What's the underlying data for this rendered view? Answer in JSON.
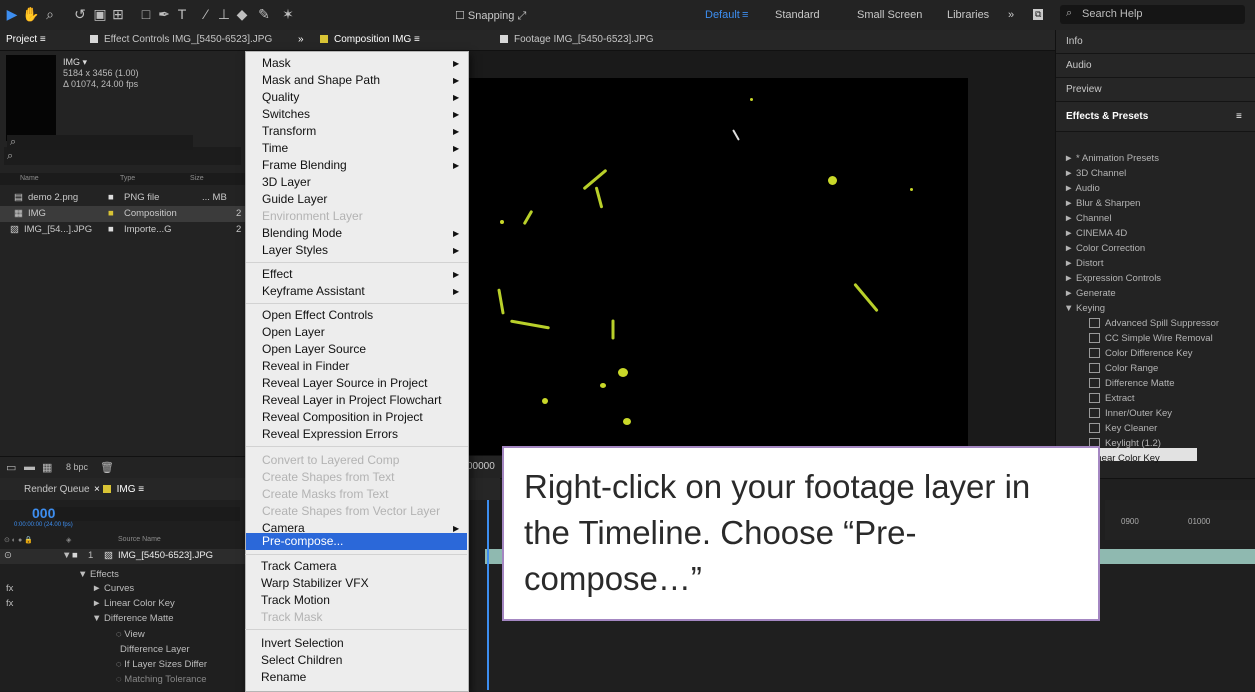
{
  "toolbar": {
    "snapping_label": "Snapping",
    "workspaces": [
      "Default",
      "Standard",
      "Small Screen",
      "Libraries"
    ],
    "overflow": "»",
    "search_placeholder": "Search Help"
  },
  "tabs": {
    "project": "Project",
    "effect_controls": "Effect Controls IMG_[5450-6523].JPG",
    "overflow": "»",
    "composition": "Composition IMG",
    "footage": "Footage IMG_[5450-6523].JPG"
  },
  "project_panel": {
    "item_name": "IMG ▾",
    "dimensions": "5184 x 3456 (1.00)",
    "duration": "Δ 01074, 24.00 fps",
    "search_icon": "⌕",
    "columns": [
      "Name",
      "Type",
      "Size"
    ],
    "rows": [
      {
        "name": "demo 2.png",
        "type": "PNG file",
        "size": "... MB"
      },
      {
        "name": "IMG",
        "type": "Composition",
        "size": "2"
      },
      {
        "name": "IMG_[54...].JPG",
        "type": "Importe...G",
        "size": "2"
      }
    ],
    "bpc": "8 bpc"
  },
  "viewer": {
    "timecode_fragment": "00000"
  },
  "right_panel": {
    "info": "Info",
    "audio": "Audio",
    "preview": "Preview",
    "effects_presets": "Effects & Presets",
    "search_icon": "⌕",
    "categories": [
      "► * Animation Presets",
      "► 3D Channel",
      "► Audio",
      "► Blur & Sharpen",
      "► Channel",
      "► CINEMA 4D",
      "► Color Correction",
      "► Distort",
      "► Expression Controls",
      "► Generate",
      "▼ Keying"
    ],
    "keying_effects": [
      "Advanced Spill Suppressor",
      "CC Simple Wire Removal",
      "Color Difference Key",
      "Color Range",
      "Difference Matte",
      "Extract",
      "Inner/Outer Key",
      "Key Cleaner",
      "Keylight (1.2)",
      "Linear Color Key"
    ]
  },
  "timeline": {
    "render_queue": "Render Queue",
    "comp_tab": "IMG",
    "timecode": "00000",
    "timecode_sub": "0:00:00:00 (24.00 fps)",
    "source_name_col": "Source Name",
    "layer_num": "1",
    "layer_name": "IMG_[5450-6523].JPG",
    "rows": [
      "Effects",
      "Curves",
      "Linear Color Key",
      "Difference Matte",
      "View",
      "Difference Layer",
      "If Layer Sizes Differ",
      "Matching Tolerance"
    ],
    "ruler": [
      "0900",
      "01000"
    ]
  },
  "context_menu": {
    "group1": [
      {
        "label": "Mask",
        "sub": true
      },
      {
        "label": "Mask and Shape Path",
        "sub": true
      },
      {
        "label": "Quality",
        "sub": true
      },
      {
        "label": "Switches",
        "sub": true
      },
      {
        "label": "Transform",
        "sub": true
      },
      {
        "label": "Time",
        "sub": true
      },
      {
        "label": "Frame Blending",
        "sub": true
      },
      {
        "label": "3D Layer",
        "sub": false
      },
      {
        "label": "Guide Layer",
        "sub": false
      },
      {
        "label": "Environment Layer",
        "sub": false,
        "disabled": true
      },
      {
        "label": "Blending Mode",
        "sub": true
      },
      {
        "label": "Layer Styles",
        "sub": true
      }
    ],
    "group2": [
      {
        "label": "Effect",
        "sub": true
      },
      {
        "label": "Keyframe Assistant",
        "sub": true
      }
    ],
    "group3": [
      "Open Effect Controls",
      "Open Layer",
      "Open Layer Source",
      "Reveal in Finder",
      "Reveal Layer Source in Project",
      "Reveal Layer in Project Flowchart",
      "Reveal Composition in Project",
      "Reveal Expression Errors"
    ],
    "group4": [
      {
        "label": "Convert to Layered Comp",
        "disabled": true
      },
      {
        "label": "Create Shapes from Text",
        "disabled": true
      },
      {
        "label": "Create Masks from Text",
        "disabled": true
      },
      {
        "label": "Create Shapes from Vector Layer",
        "disabled": true
      },
      {
        "label": "Camera",
        "sub": true
      },
      {
        "label": "Pre-compose...",
        "highlighted": true
      }
    ],
    "group5": [
      {
        "label": "Track Camera"
      },
      {
        "label": "Warp Stabilizer VFX"
      },
      {
        "label": "Track Motion"
      },
      {
        "label": "Track Mask",
        "disabled": true
      }
    ],
    "group6": [
      "Invert Selection",
      "Select Children",
      "Rename"
    ],
    "arrow": "▶"
  },
  "callout": {
    "text": "Right-click on your footage layer in the Timeline. Choose “Pre-compose…”"
  },
  "colors": {
    "accent_blue": "#3d8ef0",
    "menu_highlight": "#2b68d9",
    "callout_border": "#a487c2",
    "footage_green": "#c9d829"
  }
}
